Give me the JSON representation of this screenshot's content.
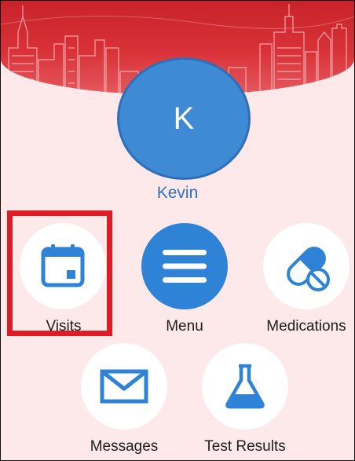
{
  "profile": {
    "initial": "K",
    "name": "Kevin"
  },
  "menu": {
    "visits": "Visits",
    "menu": "Menu",
    "medications": "Medications",
    "messages": "Messages",
    "test_results": "Test Results"
  },
  "colors": {
    "accent_blue": "#2f83d6",
    "banner_red": "#d93339",
    "highlight_red": "#e11b24",
    "background": "#fde9e9"
  }
}
